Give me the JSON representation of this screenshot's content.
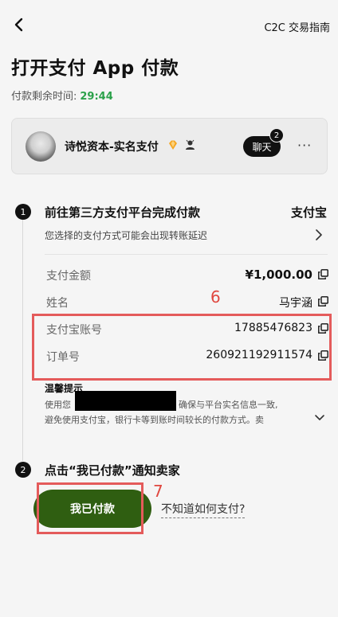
{
  "header": {
    "back_icon": "chevron-left-icon",
    "guide_link": "C2C 交易指南"
  },
  "page": {
    "title": "打开支付 App 付款",
    "timer_label": "付款剩余时间:",
    "timer_value": "29:44"
  },
  "merchant": {
    "name": "诗悦资本-实名支付",
    "chat_label": "聊天",
    "chat_count": "2",
    "more_label": "···"
  },
  "step1": {
    "number": "1",
    "title": "前往第三方支付平台完成付款",
    "method": "支付宝",
    "hint": "您选择的支付方式可能会出现转账延迟",
    "rows": [
      {
        "label": "支付金额",
        "value": "¥1,000.00"
      },
      {
        "label": "姓名",
        "value": "马宇涵"
      },
      {
        "label": "支付宝账号",
        "value": "17885476823"
      },
      {
        "label": "订单号",
        "value": "260921192911574"
      }
    ]
  },
  "notice": {
    "title": "温馨提示",
    "line1_prefix": "使用您",
    "line1_suffix": "确保与平台实名信息一致,",
    "line2": "避免使用支付宝，银行卡等到账时间较长的付款方式。卖"
  },
  "step2": {
    "number": "2",
    "title": "点击“我已付款”通知卖家",
    "pay_button": "我已付款",
    "howto_link": "不知道如何支付?"
  },
  "annotations": {
    "label6": "6",
    "label7": "7",
    "color": "#e45b5b"
  },
  "colors": {
    "accent_green": "#2ba14a",
    "button_green": "#2f5e11"
  }
}
